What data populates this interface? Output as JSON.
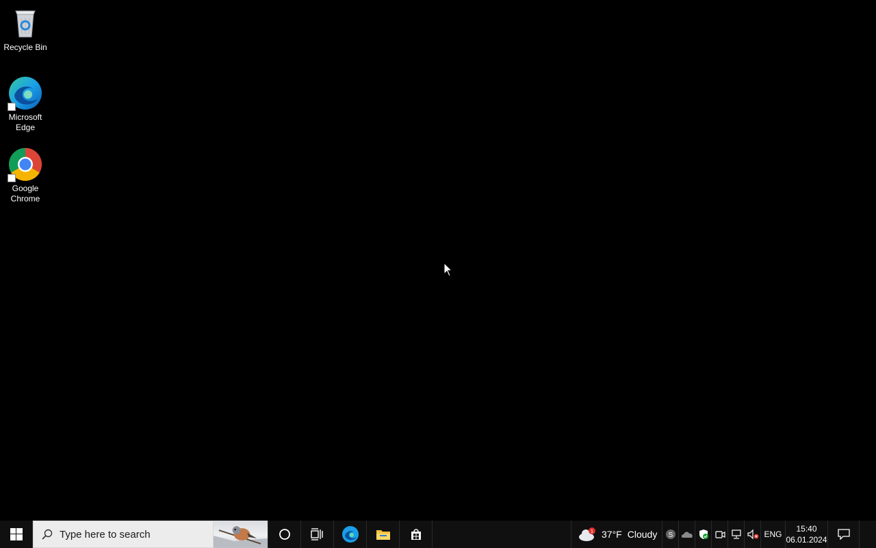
{
  "desktop": {
    "icons": [
      {
        "label": "Recycle Bin",
        "icon": "recycle-bin-icon"
      },
      {
        "label": "Microsoft Edge",
        "icon": "edge-icon"
      },
      {
        "label": "Google Chrome",
        "icon": "chrome-icon"
      }
    ]
  },
  "taskbar": {
    "search_placeholder": "Type here to search",
    "pinned": [
      "cortana-icon",
      "task-view-icon",
      "edge-icon",
      "file-explorer-icon",
      "microsoft-store-icon"
    ],
    "weather": {
      "temp": "37°F",
      "condition": "Cloudy",
      "badge": "1"
    },
    "tray": [
      "skype-icon",
      "onedrive-icon",
      "windows-security-icon",
      "meet-now-icon",
      "network-icon",
      "volume-muted-icon"
    ],
    "language": "ENG",
    "time": "15:40",
    "date": "06.01.2024"
  },
  "colors": {
    "background": "#000000",
    "taskbar": "#101010",
    "accent": "#0078d4"
  }
}
